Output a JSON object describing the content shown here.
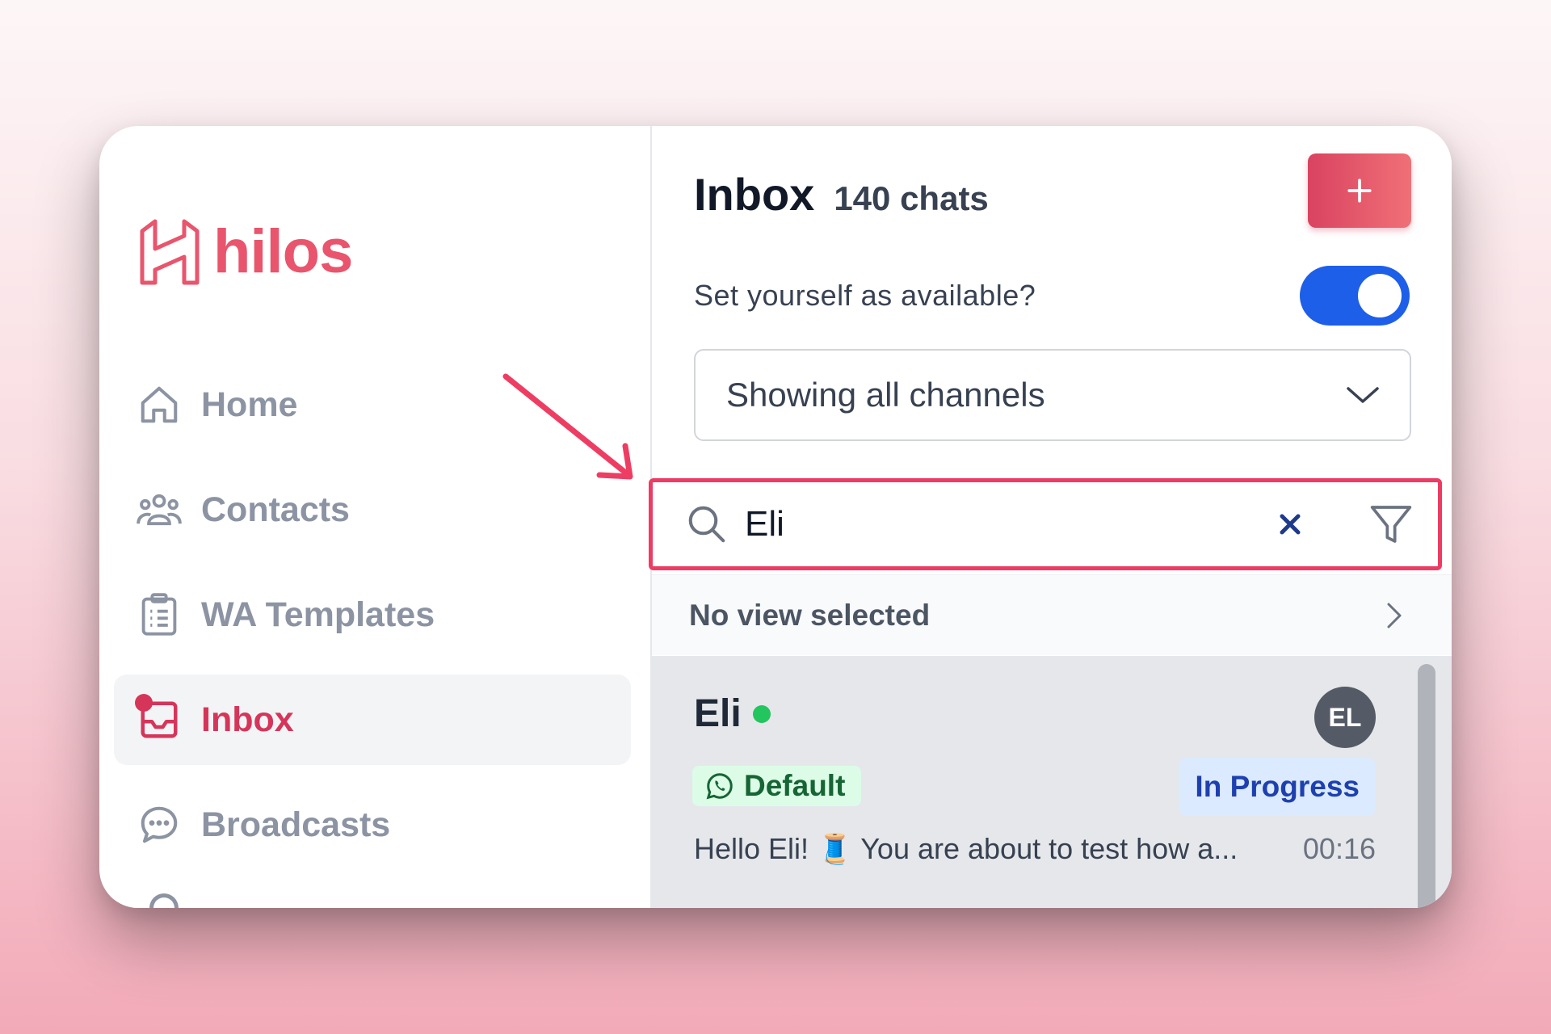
{
  "app": {
    "name": "hilos",
    "brand_color": "#e8556d",
    "accent_color": "#d6355a"
  },
  "sidebar": {
    "items": [
      {
        "label": "Home",
        "icon": "home-icon",
        "active": false
      },
      {
        "label": "Contacts",
        "icon": "users-icon",
        "active": false
      },
      {
        "label": "WA Templates",
        "icon": "clipboard-icon",
        "active": false
      },
      {
        "label": "Inbox",
        "icon": "inbox-icon",
        "active": true
      },
      {
        "label": "Broadcasts",
        "icon": "chat-bubble-icon",
        "active": false
      }
    ]
  },
  "inbox": {
    "title": "Inbox",
    "count": "140 chats",
    "new_button": "+",
    "availability_label": "Set yourself as available?",
    "available": true,
    "channel_select": "Showing all channels",
    "search": {
      "value": "Eli",
      "placeholder": ""
    },
    "view_label": "No view selected"
  },
  "chats": [
    {
      "name": "Eli",
      "online": true,
      "initials": "EL",
      "channel": "Default",
      "status": "In Progress",
      "preview": "Hello Eli! 🧵 You are about to test how a...",
      "time": "00:16"
    }
  ]
}
